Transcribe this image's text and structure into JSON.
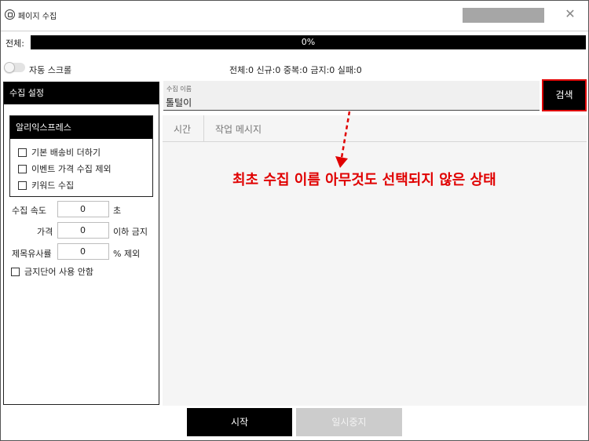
{
  "window": {
    "title": "페이지 수집"
  },
  "progress": {
    "label": "전체:",
    "percent": 0,
    "text": "0%"
  },
  "toggle": {
    "label": "자동 스크롤",
    "on": false
  },
  "stats": {
    "text": "전체:0 신규:0 중복:0 금지:0 실패:0"
  },
  "sidebar": {
    "header": "수집 설정",
    "group": {
      "title": "알리익스프레스",
      "options": [
        {
          "label": "기본 배송비 더하기",
          "checked": false
        },
        {
          "label": "이벤트 가격 수집 제외",
          "checked": false
        },
        {
          "label": "키워드 수집",
          "checked": false
        }
      ]
    },
    "speed": {
      "label": "수집 속도",
      "value": "0",
      "unit": "초"
    },
    "price": {
      "label": "가격",
      "value": "0",
      "unit": "이하 금지"
    },
    "similarity": {
      "label": "제목유사률",
      "value": "0",
      "unit": "% 제외"
    },
    "no_banned_words": {
      "label": "금지단어 사용 안함",
      "checked": false
    }
  },
  "search": {
    "caption": "수집 이름",
    "value": "톨털이",
    "button_label": "검색"
  },
  "log": {
    "columns": [
      "시간",
      "작업 메시지"
    ]
  },
  "annotation": {
    "text": "최초 수집 이름 아무것도 선택되지 않은 상태",
    "color": "#e00000"
  },
  "controls": {
    "start_label": "시작",
    "pause_label": "일시중지"
  },
  "colors": {
    "accent_dark": "#000000",
    "highlight_red": "#e00000",
    "disabled_gray": "#cccccc"
  },
  "icons": {
    "app": "app-logo-icon",
    "close": "close-icon"
  }
}
